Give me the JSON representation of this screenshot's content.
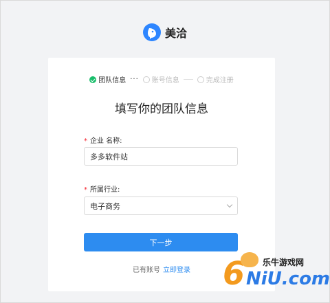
{
  "brand": {
    "name": "美洽",
    "icon": "bird-icon",
    "color": "#2e86ff"
  },
  "steps": [
    {
      "label": "团队信息",
      "state": "done"
    },
    {
      "label": "账号信息",
      "state": "pending"
    },
    {
      "label": "完成注册",
      "state": "pending"
    }
  ],
  "steps_separator": "···",
  "form": {
    "title": "填写你的团队信息",
    "company_label": "企业 名称:",
    "company_value": "多多软件站",
    "industry_label": "所属行业:",
    "industry_value": "电子商务",
    "required_mark": "*",
    "next_button": "下一步"
  },
  "footer": {
    "has_account": "已有账号",
    "login_link": "立即登录"
  },
  "watermark": {
    "number": "6",
    "top_text": "乐牛游戏网",
    "bottom_text": "NiU.com"
  },
  "colors": {
    "primary": "#2d8cf0",
    "success": "#19be6b",
    "required": "#f5222d"
  }
}
